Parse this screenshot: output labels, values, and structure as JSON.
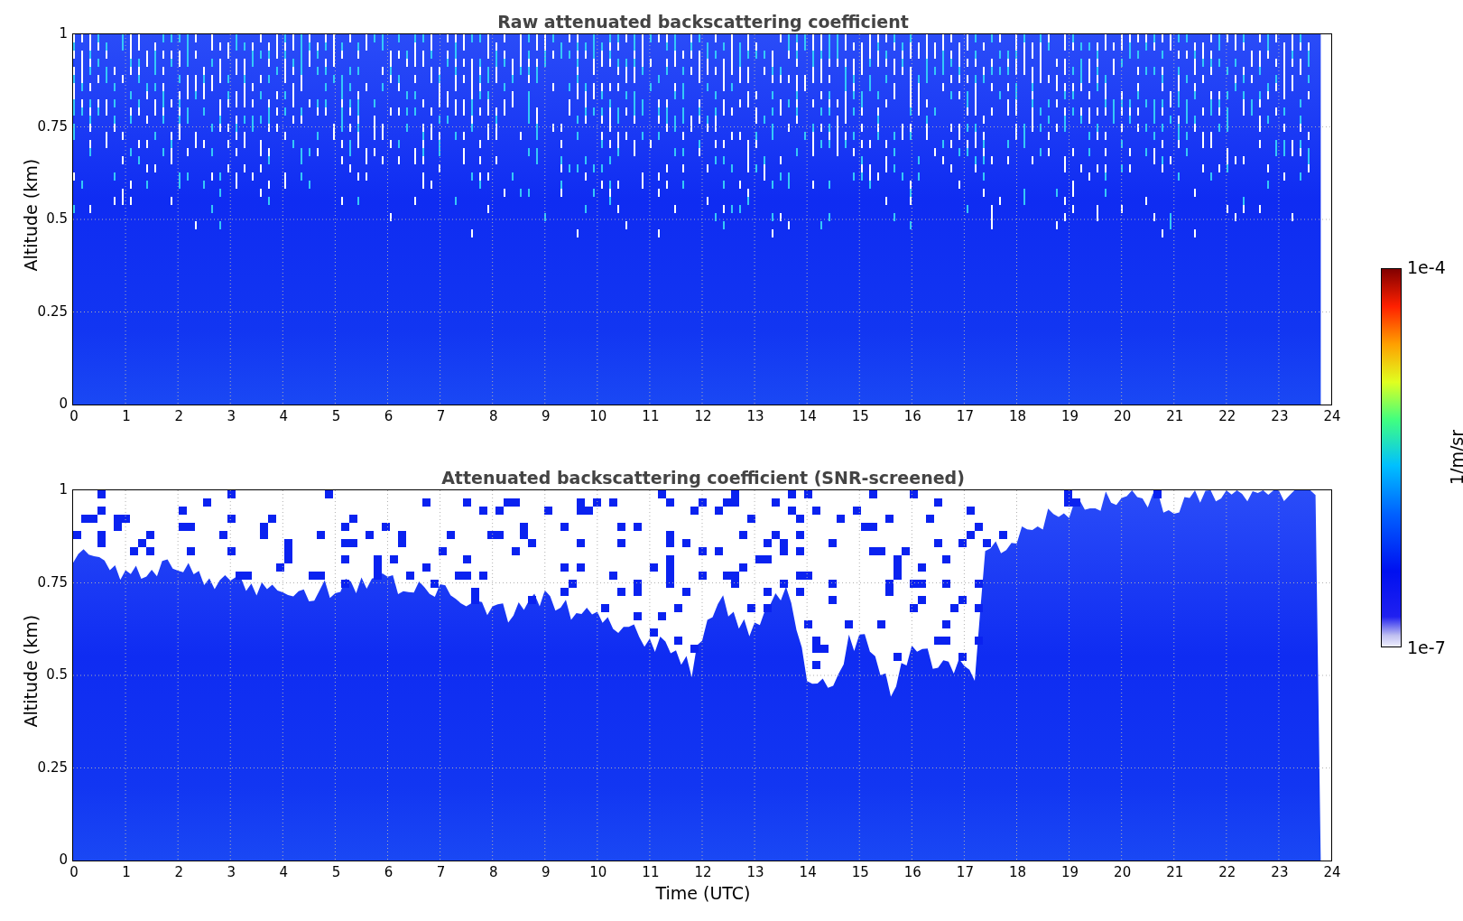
{
  "plots": [
    {
      "kind": "raw",
      "title": "Raw attenuated backscattering coefficient",
      "ylabel": "Altitude (km)",
      "yticks": [
        "1",
        "0.75",
        "0.5",
        "0.25",
        "0"
      ],
      "xticks": [
        "0",
        "1",
        "2",
        "3",
        "4",
        "5",
        "6",
        "7",
        "8",
        "9",
        "10",
        "11",
        "12",
        "13",
        "14",
        "15",
        "16",
        "17",
        "18",
        "19",
        "20",
        "21",
        "22",
        "23",
        "24"
      ]
    },
    {
      "kind": "screened",
      "title": "Attenuated backscattering coefficient (SNR-screened)",
      "ylabel": "Altitude (km)",
      "yticks": [
        "1",
        "0.75",
        "0.5",
        "0.25",
        "0"
      ],
      "xticks": [
        "0",
        "1",
        "2",
        "3",
        "4",
        "5",
        "6",
        "7",
        "8",
        "9",
        "10",
        "11",
        "12",
        "13",
        "14",
        "15",
        "16",
        "17",
        "18",
        "19",
        "20",
        "21",
        "22",
        "23",
        "24"
      ],
      "xlabel": "Time (UTC)"
    }
  ],
  "colorbar": {
    "max_label": "1e-4",
    "min_label": "1e-7",
    "label": "1/m/sr"
  }
}
